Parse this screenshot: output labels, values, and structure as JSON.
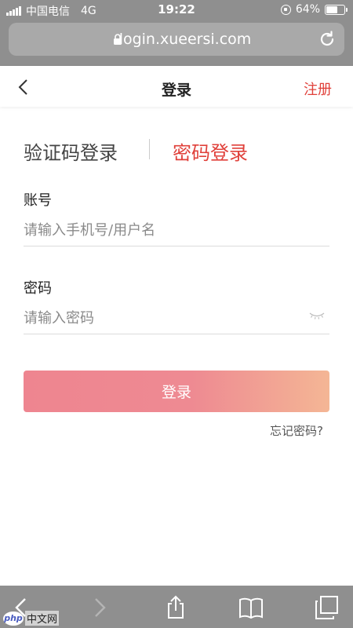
{
  "status_bar": {
    "carrier": "中国电信",
    "network": "4G",
    "time": "19:22",
    "battery": "64%",
    "battery_level": 0.64
  },
  "browser": {
    "url": "login.xueersi.com"
  },
  "header": {
    "title": "登录",
    "register_label": "注册"
  },
  "tabs": [
    {
      "label": "验证码登录",
      "active": false
    },
    {
      "label": "密码登录",
      "active": true
    }
  ],
  "form": {
    "account_label": "账号",
    "account_placeholder": "请输入手机号/用户名",
    "password_label": "密码",
    "password_placeholder": "请输入密码",
    "submit_label": "登录",
    "forgot_label": "忘记密码?"
  },
  "watermark": {
    "logo": "php",
    "text": "中文网"
  },
  "colors": {
    "accent": "#e0403a",
    "button_start": "#ee8590",
    "button_end": "#f4b695",
    "chrome": "#8f8f8f"
  }
}
